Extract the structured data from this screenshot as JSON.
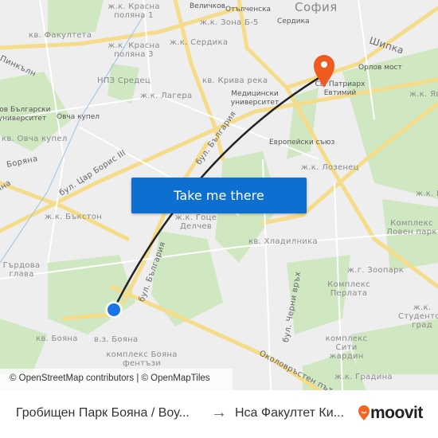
{
  "map": {
    "city": "София",
    "labels": [
      "ж.к. Красна поляна 1",
      "Величков",
      "Отълченска",
      "кв. Факултета",
      "ж.к. Зона Б-5",
      "Сердика",
      "ж.к. Красна поляна 3",
      "ж.к. Сердика",
      "Шипка",
      "Пинкълн",
      "НПЗ Средец",
      "кв. Крива река",
      "Орлов мост",
      "ж.к. Лагера",
      "Медицински университет",
      "Св. Патриарх Евтимий",
      "ж.к. Яв",
      "Нов Български университет",
      "Овча купел",
      "кв. Овча купел",
      "бул. България",
      "Европейски съюз",
      "Боряна",
      "бул. Цар Борис III",
      "ж.к. Лозенец",
      "ж.к. Бъкстон",
      "ж.к. Гоце Делчев",
      "кв. Хладилника",
      "Комплекс Ловен парк",
      "ж.к. Из",
      "Гърдова глава",
      "бул. България",
      "Комплекс Перлата",
      "ж.г. Зоопарк",
      "бул. Черни връх",
      "ж.к. Студентски град",
      "кв. Бояна",
      "в.з. Бояна",
      "комплекс Бояна фентъзи",
      "комплекс Сити жардин",
      "Околовръстен път",
      "ж.к. Градина",
      "Бляна"
    ],
    "button_label": "Take me there",
    "attribution": "© OpenStreetMap contributors | © OpenMapTiles",
    "route_color": "#222222",
    "destination_pin_color": "#ef5a1f",
    "origin_marker_color": "#1a73e8"
  },
  "bottom_bar": {
    "from": "Гробищен Парк Бояна / Воу...",
    "arrow": "→",
    "to": "Нса Факултет Ки...",
    "brand": "moovit",
    "brand_color": "#f26522"
  }
}
